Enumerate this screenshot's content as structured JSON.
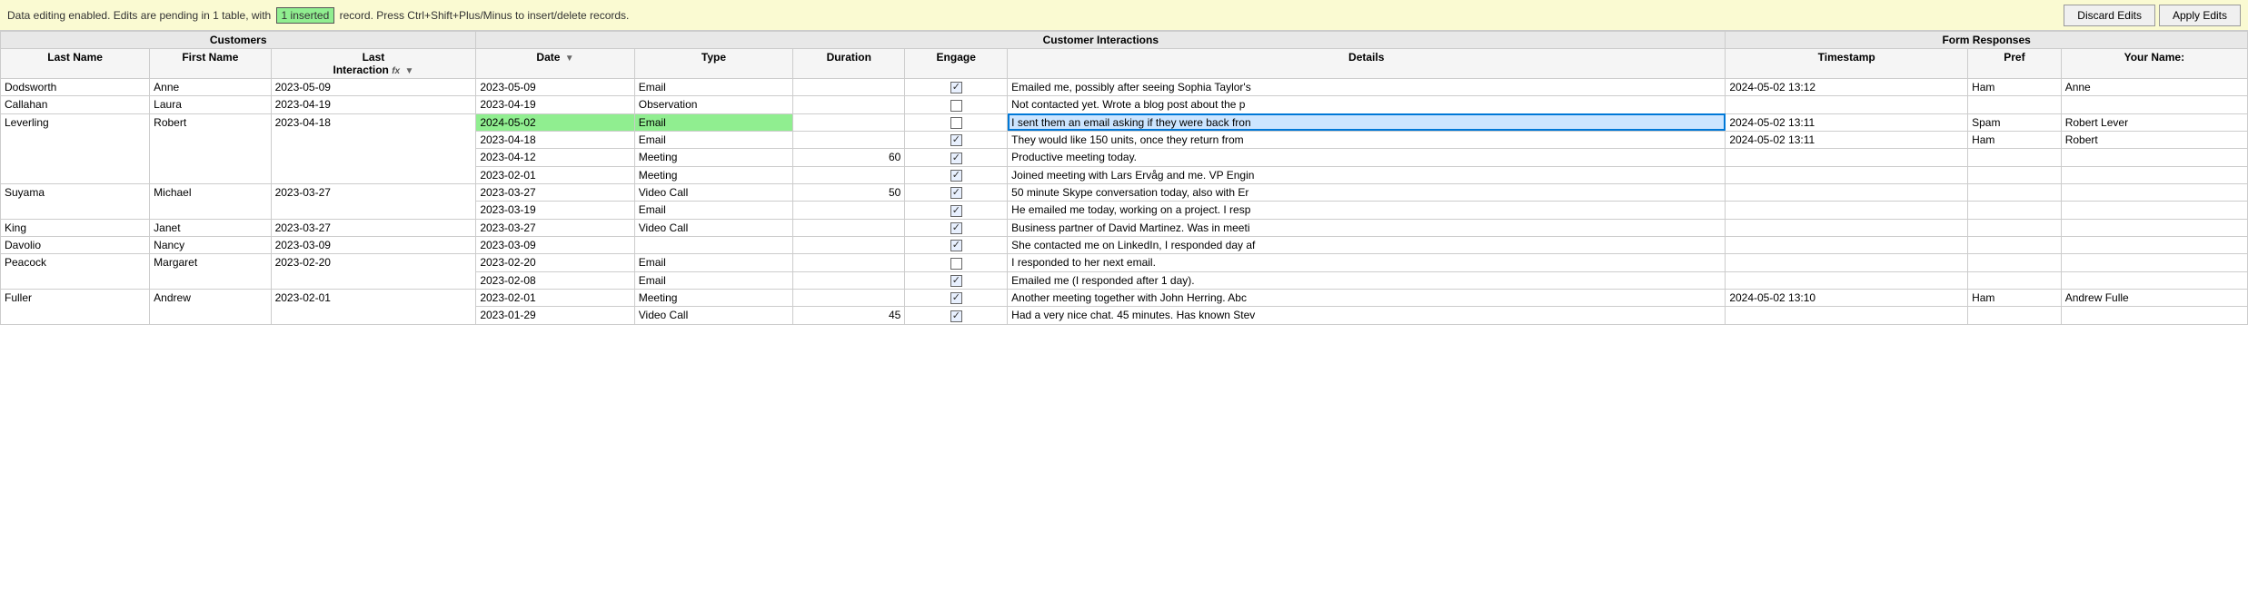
{
  "notification": {
    "text_before": "Data editing enabled. Edits are pending in 1 table, with",
    "badge": "1 inserted",
    "text_after": "record. Press Ctrl+Shift+Plus/Minus to insert/delete records.",
    "discard_label": "Discard Edits",
    "apply_label": "Apply Edits"
  },
  "table": {
    "group_label": "Customers",
    "sections": {
      "customers": {
        "label": "Customers",
        "cols": [
          "Last Name",
          "First Name",
          "Last Interaction"
        ]
      },
      "customer_interactions": {
        "label": "Customer Interactions",
        "cols": [
          "Date",
          "Type",
          "Duration",
          "Engage",
          "Details"
        ]
      },
      "form_responses": {
        "label": "Form Responses",
        "cols": [
          "Timestamp",
          "Pref",
          "Your Name:"
        ]
      }
    },
    "rows": [
      {
        "lastname": "Dodsworth",
        "firstname": "Anne",
        "last_interaction": "2023-05-09",
        "interactions": [
          {
            "date": "2023-05-09",
            "type": "Email",
            "duration": "",
            "engage": true,
            "details": "Emailed me, possibly after seeing Sophia Taylor's",
            "timestamp": "2024-05-02 13:12",
            "pref": "Ham",
            "yourname": "Anne",
            "inserted": false,
            "selected": false
          }
        ]
      },
      {
        "lastname": "Callahan",
        "firstname": "Laura",
        "last_interaction": "2023-04-19",
        "interactions": [
          {
            "date": "2023-04-19",
            "type": "Observation",
            "duration": "",
            "engage": false,
            "details": "Not contacted yet. Wrote a blog post about the p",
            "timestamp": "",
            "pref": "",
            "yourname": "",
            "inserted": false,
            "selected": false
          }
        ]
      },
      {
        "lastname": "Leverling",
        "firstname": "Robert",
        "last_interaction": "2023-04-18",
        "interactions": [
          {
            "date": "2024-05-02",
            "type": "Email",
            "duration": "",
            "engage": false,
            "details": "I sent them an email asking if they were back fron",
            "timestamp": "2024-05-02 13:11",
            "pref": "Spam",
            "yourname": "Robert Lever",
            "inserted": true,
            "selected": true
          },
          {
            "date": "2023-04-18",
            "type": "Email",
            "duration": "",
            "engage": true,
            "details": "They would like 150 units, once they return from",
            "timestamp": "2024-05-02 13:11",
            "pref": "Ham",
            "yourname": "Robert",
            "inserted": false,
            "selected": false
          },
          {
            "date": "2023-04-12",
            "type": "Meeting",
            "duration": "60",
            "engage": true,
            "details": "Productive meeting today.",
            "timestamp": "",
            "pref": "",
            "yourname": "",
            "inserted": false,
            "selected": false
          },
          {
            "date": "2023-02-01",
            "type": "Meeting",
            "duration": "",
            "engage": true,
            "details": "Joined meeting with Lars Ervåg and me. VP Engin",
            "timestamp": "",
            "pref": "",
            "yourname": "",
            "inserted": false,
            "selected": false
          }
        ]
      },
      {
        "lastname": "Suyama",
        "firstname": "Michael",
        "last_interaction": "2023-03-27",
        "interactions": [
          {
            "date": "2023-03-27",
            "type": "Video Call",
            "duration": "50",
            "engage": true,
            "details": "50 minute Skype conversation today, also with Er",
            "timestamp": "",
            "pref": "",
            "yourname": "",
            "inserted": false,
            "selected": false
          },
          {
            "date": "2023-03-19",
            "type": "Email",
            "duration": "",
            "engage": true,
            "details": "He emailed me today, working on a project. I resp",
            "timestamp": "",
            "pref": "",
            "yourname": "",
            "inserted": false,
            "selected": false
          }
        ]
      },
      {
        "lastname": "King",
        "firstname": "Janet",
        "last_interaction": "2023-03-27",
        "interactions": [
          {
            "date": "2023-03-27",
            "type": "Video Call",
            "duration": "",
            "engage": true,
            "details": "Business partner of David Martinez. Was in meeti",
            "timestamp": "",
            "pref": "",
            "yourname": "",
            "inserted": false,
            "selected": false
          }
        ]
      },
      {
        "lastname": "Davolio",
        "firstname": "Nancy",
        "last_interaction": "2023-03-09",
        "interactions": [
          {
            "date": "2023-03-09",
            "type": "",
            "duration": "",
            "engage": true,
            "details": "She contacted me on LinkedIn, I responded day af",
            "timestamp": "",
            "pref": "",
            "yourname": "",
            "inserted": false,
            "selected": false
          }
        ]
      },
      {
        "lastname": "Peacock",
        "firstname": "Margaret",
        "last_interaction": "2023-02-20",
        "interactions": [
          {
            "date": "2023-02-20",
            "type": "Email",
            "duration": "",
            "engage": false,
            "details": "I responded to her next email.",
            "timestamp": "",
            "pref": "",
            "yourname": "",
            "inserted": false,
            "selected": false
          },
          {
            "date": "2023-02-08",
            "type": "Email",
            "duration": "",
            "engage": true,
            "details": "Emailed me (I responded after 1 day).",
            "timestamp": "",
            "pref": "",
            "yourname": "",
            "inserted": false,
            "selected": false
          }
        ]
      },
      {
        "lastname": "Fuller",
        "firstname": "Andrew",
        "last_interaction": "2023-02-01",
        "interactions": [
          {
            "date": "2023-02-01",
            "type": "Meeting",
            "duration": "",
            "engage": true,
            "details": "Another meeting together with John Herring. Abc",
            "timestamp": "2024-05-02 13:10",
            "pref": "Ham",
            "yourname": "Andrew Fulle",
            "inserted": false,
            "selected": false
          },
          {
            "date": "2023-01-29",
            "type": "Video Call",
            "duration": "45",
            "engage": true,
            "details": "Had a very nice chat. 45 minutes. Has known Stev",
            "timestamp": "",
            "pref": "",
            "yourname": "",
            "inserted": false,
            "selected": false
          }
        ]
      }
    ]
  }
}
